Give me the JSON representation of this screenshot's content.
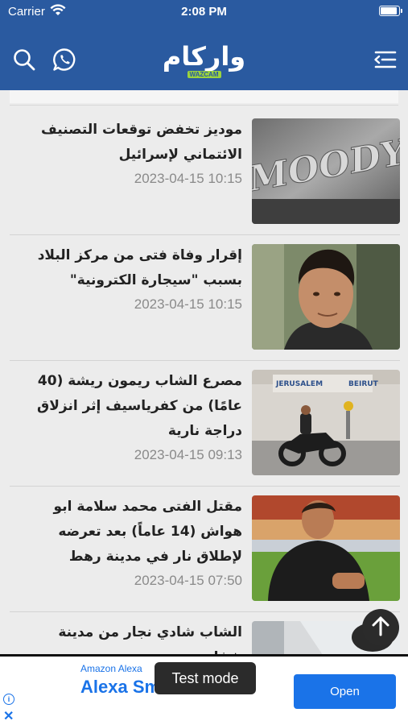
{
  "status_bar": {
    "carrier": "Carrier",
    "time": "2:08 PM"
  },
  "header": {
    "logo_ar": "واركام",
    "logo_en": "WAZCAM"
  },
  "articles": [
    {
      "title": "موديز تخفض توقعات التصنيف الائتماني لإسرائيل",
      "date": "2023-04-15 10:15",
      "thumb_text": "MOODY"
    },
    {
      "title": "إقرار وفاة فتى من مركز البلاد بسبب \"سيجارة الكترونية\"",
      "date": "2023-04-15 10:15"
    },
    {
      "title": "مصرع الشاب ريمون ريشة (40 عامًا) من كفرياسيف إثر انزلاق دراجة نارية",
      "date": "2023-04-15 09:13",
      "thumb_text": "JERUSALEM"
    },
    {
      "title": "مقتل الفتى محمد سلامة ابو هواش (14 عاماً) بعد تعرضه لإطلاق نار في مدينة رهط",
      "date": "2023-04-15 07:50"
    },
    {
      "title": "الشاب شادي نجار من مدينة شفاعمرو",
      "date": ""
    }
  ],
  "ad": {
    "sponsor": "Amazon Alexa",
    "headline": "Alexa Sm   Dev Kit",
    "open_label": "Open",
    "info_label": "i",
    "close_label": "✕"
  },
  "toast": {
    "label": "Test mode"
  },
  "colors": {
    "brand": "#2a5aa0",
    "accent": "#9bd33e",
    "ad_blue": "#1a73e8"
  },
  "icons": [
    "wifi-icon",
    "battery-icon",
    "search-icon",
    "whatsapp-icon",
    "menu-icon",
    "arrow-up-icon",
    "info-icon",
    "close-icon"
  ]
}
